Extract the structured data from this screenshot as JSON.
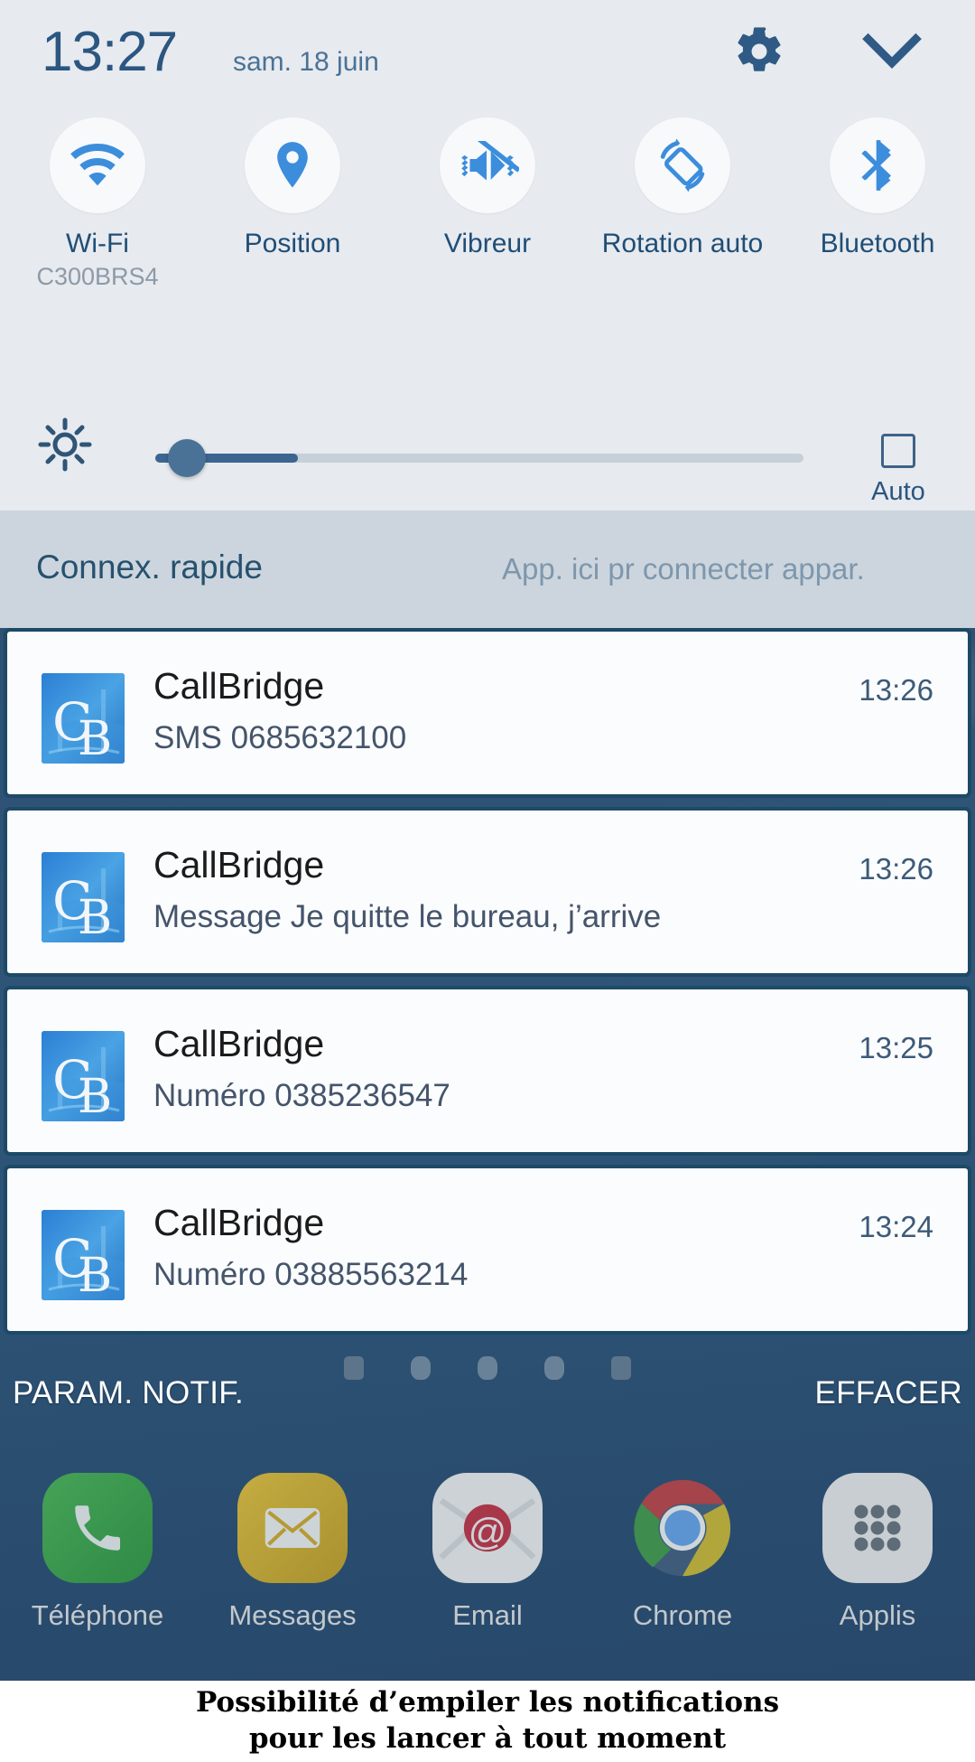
{
  "status_bar": {
    "clock": "13:27",
    "date": "sam. 18 juin",
    "gear_icon": "gear-icon",
    "collapse_icon": "chevron-down-icon"
  },
  "quick_toggles": [
    {
      "label": "Wi-Fi",
      "sub": "C300BRS4",
      "icon": "wifi-icon",
      "active": true
    },
    {
      "label": "Position",
      "sub": "",
      "icon": "location-pin-icon",
      "active": true
    },
    {
      "label": "Vibreur",
      "sub": "",
      "icon": "vibrate-mute-icon",
      "active": true
    },
    {
      "label": "Rotation auto",
      "sub": "",
      "icon": "screen-rotation-icon",
      "active": true
    },
    {
      "label": "Bluetooth",
      "sub": "",
      "icon": "bluetooth-icon",
      "active": true
    }
  ],
  "brightness": {
    "icon": "brightness-sun-icon",
    "value_percent": 22,
    "auto_label": "Auto",
    "auto_checked": false
  },
  "quick_connect": {
    "title": "Connex. rapide",
    "hint": "App. ici pr connecter appar."
  },
  "notifications": [
    {
      "app": "CallBridge",
      "body": "SMS 0685632100",
      "time": "13:26",
      "icon": "callbridge-app-icon"
    },
    {
      "app": "CallBridge",
      "body": "Message Je quitte le bureau, j’arrive",
      "time": "13:26",
      "icon": "callbridge-app-icon"
    },
    {
      "app": "CallBridge",
      "body": "Numéro 0385236547",
      "time": "13:25",
      "icon": "callbridge-app-icon"
    },
    {
      "app": "CallBridge",
      "body": "Numéro 03885563214",
      "time": "13:24",
      "icon": "callbridge-app-icon"
    }
  ],
  "notif_actions": {
    "settings_label": "PARAM. NOTIF.",
    "clear_label": "EFFACER"
  },
  "dock": [
    {
      "label": "Téléphone",
      "icon": "phone-icon",
      "color": "#3f9a4f"
    },
    {
      "label": "Messages",
      "icon": "envelope-icon",
      "color": "#b9a13a"
    },
    {
      "label": "Email",
      "icon": "email-at-icon",
      "color": "#ccd2d6"
    },
    {
      "label": "Chrome",
      "icon": "chrome-icon",
      "color": "#ffffff"
    },
    {
      "label": "Applis",
      "icon": "app-grid-icon",
      "color": "#c9ced3"
    }
  ],
  "caption": {
    "line1": "Possibilité d’empiler les notifications",
    "line2": "pour les lancer à tout moment"
  },
  "colors": {
    "panel_bg": "#e7eaef",
    "quick_connect_bg": "#ccd5dd",
    "accent_blue": "#3c8ddc",
    "text_dark_blue": "#1f4e76",
    "wallpaper": "#2d5174",
    "notif_border": "#1d4a66"
  }
}
